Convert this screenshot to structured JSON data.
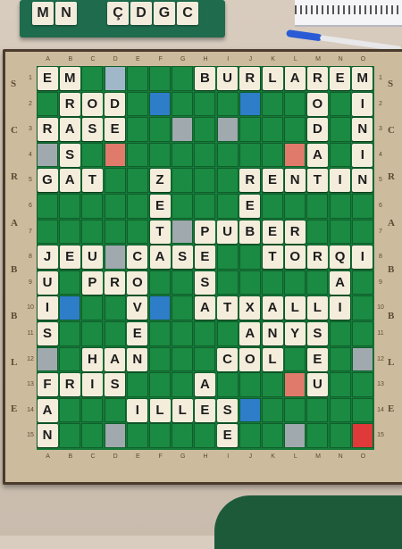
{
  "rack": {
    "letters": [
      "M",
      "N",
      "Ç",
      "D",
      "G",
      "C"
    ]
  },
  "board": {
    "columns": [
      "A",
      "B",
      "C",
      "D",
      "E",
      "F",
      "G",
      "H",
      "I",
      "J",
      "K",
      "L",
      "M",
      "N",
      "O"
    ],
    "rows": [
      "1",
      "2",
      "3",
      "4",
      "5",
      "6",
      "7",
      "8",
      "9",
      "10",
      "11",
      "12",
      "13",
      "14",
      "15"
    ],
    "side_words": [
      "S",
      "C",
      "R",
      "A",
      "B",
      "B",
      "L",
      "E"
    ],
    "words": [
      {
        "word": "EM"
      },
      {
        "word": "ROD"
      },
      {
        "word": "ASE"
      },
      {
        "word": "GATZE"
      },
      {
        "word": "BURLAREM"
      },
      {
        "word": "ODA"
      },
      {
        "word": "INI"
      },
      {
        "word": "RENTIN"
      },
      {
        "word": "TPUBER"
      },
      {
        "word": "JEU"
      },
      {
        "word": "CASE"
      },
      {
        "word": "TORQI"
      },
      {
        "word": "PRO"
      },
      {
        "word": "ATXALLI"
      },
      {
        "word": "ANYS"
      },
      {
        "word": "HAN"
      },
      {
        "word": "COL"
      },
      {
        "word": "FRIS"
      },
      {
        "word": "ILLES"
      },
      {
        "word": "AN"
      }
    ]
  }
}
